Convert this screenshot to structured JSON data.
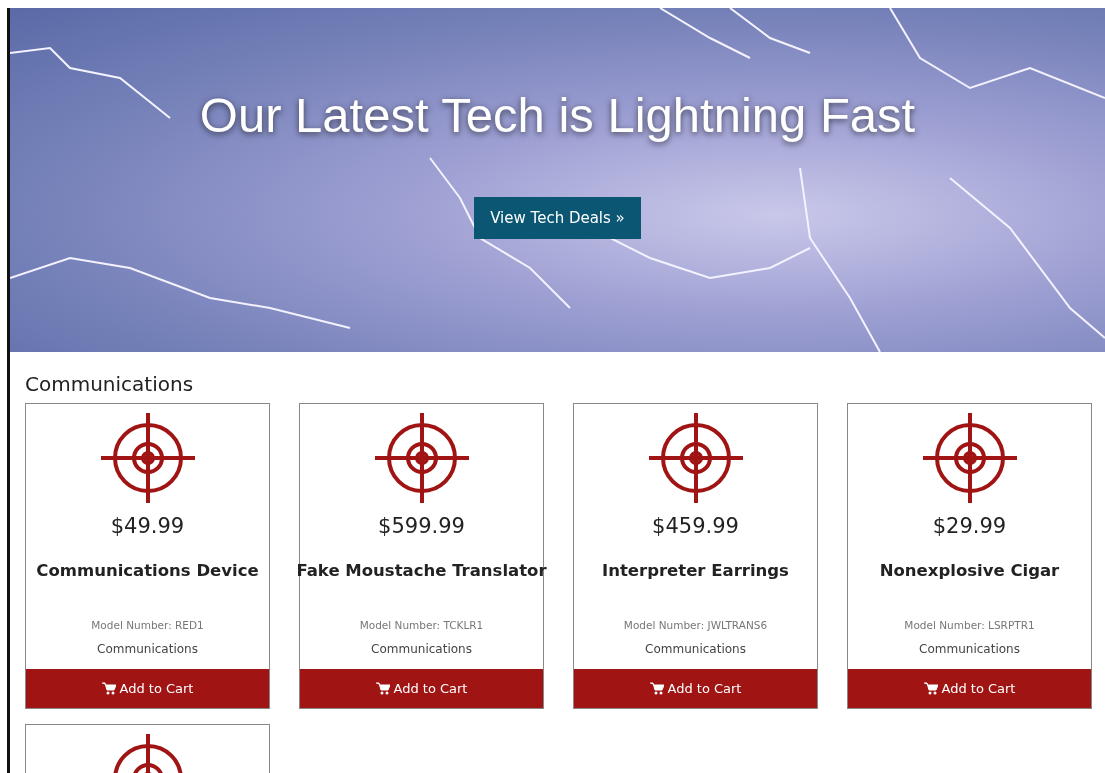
{
  "hero": {
    "title": "Our Latest Tech is Lightning Fast",
    "button": "View Tech Deals »"
  },
  "section": {
    "title": "Communications"
  },
  "products": [
    {
      "kind": "full",
      "price": "$49.99",
      "name": "Communications Device",
      "model_label": "Model Number:",
      "model": "RED1",
      "category": "Communications",
      "button": "Add to Cart"
    },
    {
      "kind": "full",
      "price": "$599.99",
      "name": "Fake Moustache Translator",
      "model_label": "Model Number:",
      "model": "TCKLR1",
      "category": "Communications",
      "button": "Add to Cart"
    },
    {
      "kind": "full",
      "price": "$459.99",
      "name": "Interpreter Earrings",
      "model_label": "Model Number:",
      "model": "JWLTRANS6",
      "category": "Communications",
      "button": "Add to Cart"
    },
    {
      "kind": "full",
      "price": "$29.99",
      "name": "Nonexplosive Cigar",
      "model_label": "Model Number:",
      "model": "LSRPTR1",
      "category": "Communications",
      "button": "Add to Cart"
    },
    {
      "kind": "partial"
    }
  ]
}
